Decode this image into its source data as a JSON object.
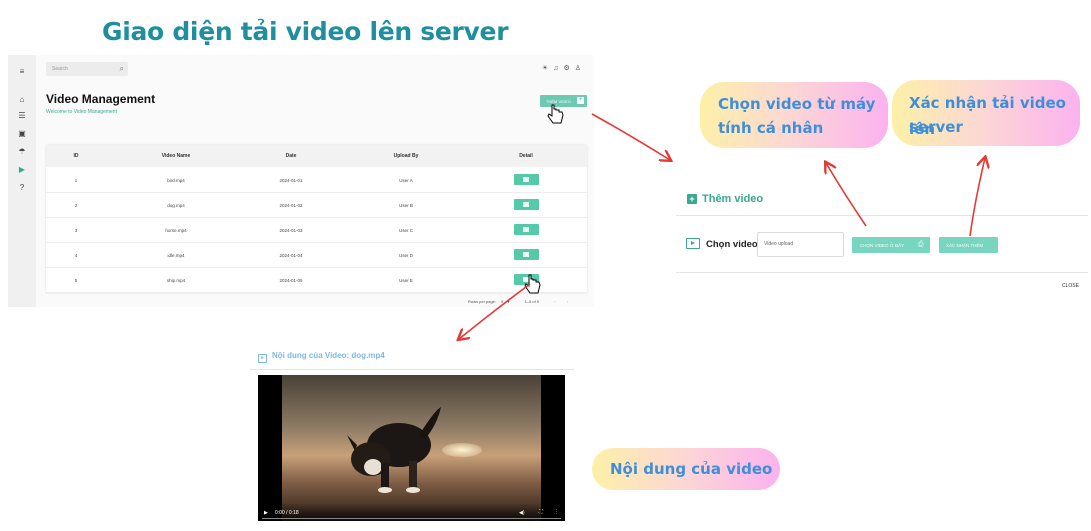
{
  "page_title": "Giao diện tải video lên server",
  "app": {
    "search_placeholder": "Search",
    "title": "Video Management",
    "subtitle": "Welcome to Video Management",
    "add_button": "THÊM VIDEO",
    "table": {
      "headers": [
        "ID",
        "Video Name",
        "Date",
        "Upload By",
        "Detail"
      ],
      "rows": [
        {
          "id": "1",
          "name": "bird.mp4",
          "date": "2024-01-01",
          "by": "User A"
        },
        {
          "id": "2",
          "name": "dog.mp4",
          "date": "2024-01-02",
          "by": "User B"
        },
        {
          "id": "3",
          "name": "horse.mp4",
          "date": "2024-01-03",
          "by": "User C"
        },
        {
          "id": "4",
          "name": "idle.mp4",
          "date": "2024-01-04",
          "by": "User D"
        },
        {
          "id": "5",
          "name": "ship.mp4",
          "date": "2024-01-05",
          "by": "User E"
        }
      ]
    },
    "rows_per_page_label": "Rows per page:",
    "rows_per_page_value": "5",
    "page_range": "1–5 of 5"
  },
  "callouts": {
    "choose_video": "Chọn video từ máy tính cá nhân",
    "choose_video_line1": "Chọn video từ máy",
    "choose_video_line2": "tính cá nhân",
    "confirm_upload_line1": "Xác nhận tải video lên",
    "confirm_upload_line2": "server",
    "video_content": "Nội dung của video"
  },
  "dialog": {
    "title": "Thêm video",
    "choose_label": "Chọn video",
    "input_value": "Video upload",
    "choose_button": "CHỌN VIDEO Ở ĐÂY",
    "confirm_button": "XÁC NHẬN THÊM",
    "close": "CLOSE"
  },
  "video": {
    "title": "Nội dung của Video: dog.mp4",
    "time": "0:00 / 0:18"
  },
  "colors": {
    "title": "#1f8fa0",
    "accent": "#55c9a8",
    "callout_text": "#3f8fd8",
    "arrow": "#e53935"
  }
}
